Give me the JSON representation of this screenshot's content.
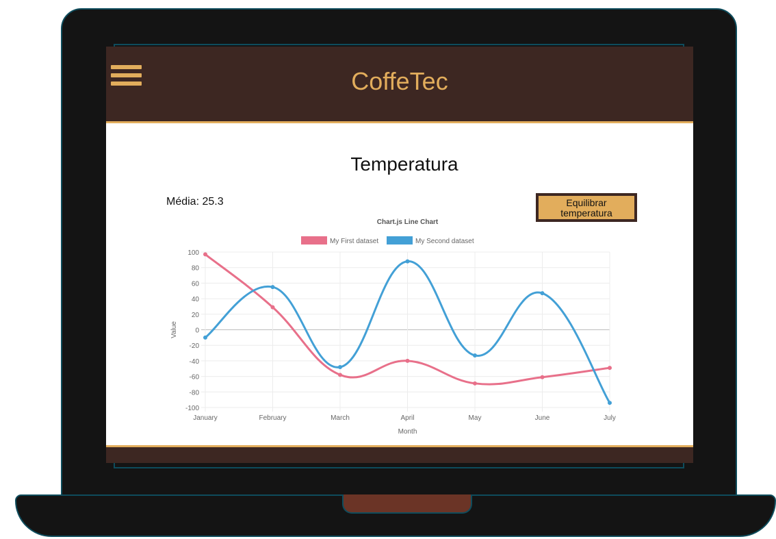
{
  "app": {
    "title": "CoffeTec"
  },
  "page": {
    "title": "Temperatura",
    "media_label": "Média: 25.3"
  },
  "actions": {
    "equilibrar_line1": "Equilibrar",
    "equilibrar_line2": "temperatura"
  },
  "icons": {
    "menu": "hamburger-menu-icon"
  },
  "colors": {
    "header_bg": "#3d2722",
    "accent": "#e2ad5c",
    "series1": "#e8708a",
    "series2": "#43a0d6"
  },
  "chart_data": {
    "type": "line",
    "title": "Chart.js Line Chart",
    "xlabel": "Month",
    "ylabel": "Value",
    "categories": [
      "January",
      "February",
      "March",
      "April",
      "May",
      "June",
      "July"
    ],
    "ylim": [
      -100,
      100
    ],
    "yticks": [
      100,
      80,
      60,
      40,
      20,
      0,
      -20,
      -40,
      -60,
      -80,
      -100
    ],
    "legend_position": "top",
    "grid": true,
    "series": [
      {
        "name": "My First dataset",
        "color": "#e8708a",
        "values": [
          97,
          29,
          -58,
          -40,
          -69,
          -61,
          -49
        ]
      },
      {
        "name": "My Second dataset",
        "color": "#43a0d6",
        "values": [
          -10,
          55,
          -48,
          88,
          -33,
          47,
          -94
        ]
      }
    ]
  }
}
